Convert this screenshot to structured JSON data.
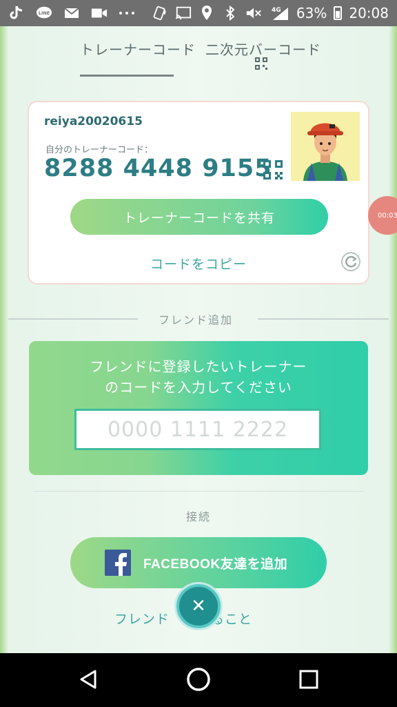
{
  "status_bar": {
    "left_icons": [
      "tiktok-icon",
      "line-icon",
      "mail-icon",
      "video-icon",
      "more-icon"
    ],
    "line_label": "LINE",
    "right_icons": [
      "nfc-icon",
      "cast-icon",
      "location-icon",
      "bluetooth-icon",
      "mute-icon",
      "signal-4g-icon",
      "battery-icon"
    ],
    "network": "4G",
    "battery": "63%",
    "time": "20:08"
  },
  "tabs": [
    {
      "label": "トレーナーコード",
      "active": true
    },
    {
      "label": "二次元バーコード",
      "active": false,
      "icon": "qr-code-icon"
    }
  ],
  "trainer_card": {
    "username": "reiya20020615",
    "code_label": "自分のトレーナーコード：",
    "code_value": "8288 4448 9155",
    "share_button": "トレーナーコードを共有",
    "copy_link": "コードをコピー",
    "refresh_icon": "refresh-icon"
  },
  "recording_badge": "00:03",
  "friend_section": {
    "title": "フレンド追加",
    "prompt": "フレンドに登録したいトレーナーのコードを入力してください",
    "input_placeholder": "0000 1111 2222"
  },
  "connect_section": {
    "title": "接続",
    "facebook_button": "FACEBOOK友達を追加",
    "bottom_link": "フレンドとされること"
  },
  "colors": {
    "accent": "#2d7d84",
    "link": "#3aa6a0",
    "button_gradient_start": "#9fd886",
    "button_gradient_end": "#2fcfa8",
    "facebook": "#3b5998"
  }
}
